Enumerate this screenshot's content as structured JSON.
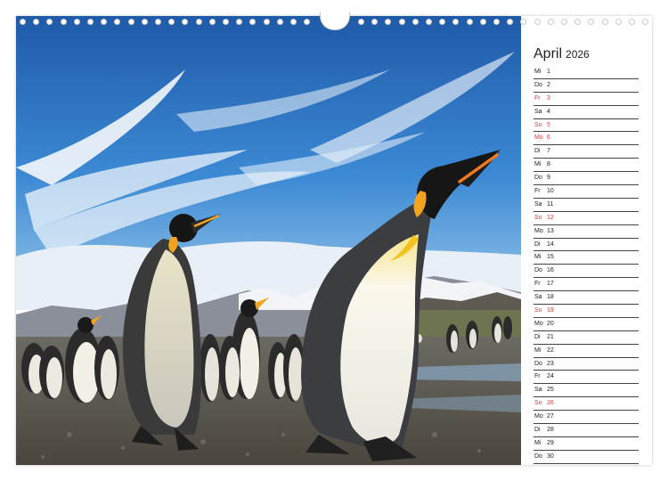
{
  "calendar": {
    "month": "April",
    "year": "2026",
    "days": [
      {
        "wd": "Mi",
        "d": "1",
        "red": false
      },
      {
        "wd": "Do",
        "d": "2",
        "red": false
      },
      {
        "wd": "Fr",
        "d": "3",
        "red": true
      },
      {
        "wd": "Sa",
        "d": "4",
        "red": false
      },
      {
        "wd": "So",
        "d": "5",
        "red": true
      },
      {
        "wd": "Mo",
        "d": "6",
        "red": true
      },
      {
        "wd": "Di",
        "d": "7",
        "red": false
      },
      {
        "wd": "Mi",
        "d": "8",
        "red": false
      },
      {
        "wd": "Do",
        "d": "9",
        "red": false
      },
      {
        "wd": "Fr",
        "d": "10",
        "red": false
      },
      {
        "wd": "Sa",
        "d": "11",
        "red": false
      },
      {
        "wd": "So",
        "d": "12",
        "red": true
      },
      {
        "wd": "Mo",
        "d": "13",
        "red": false
      },
      {
        "wd": "Di",
        "d": "14",
        "red": false
      },
      {
        "wd": "Mi",
        "d": "15",
        "red": false
      },
      {
        "wd": "Do",
        "d": "16",
        "red": false
      },
      {
        "wd": "Fr",
        "d": "17",
        "red": false
      },
      {
        "wd": "Sa",
        "d": "18",
        "red": false
      },
      {
        "wd": "So",
        "d": "19",
        "red": true
      },
      {
        "wd": "Mo",
        "d": "20",
        "red": false
      },
      {
        "wd": "Di",
        "d": "21",
        "red": false
      },
      {
        "wd": "Mi",
        "d": "22",
        "red": false
      },
      {
        "wd": "Do",
        "d": "23",
        "red": false
      },
      {
        "wd": "Fr",
        "d": "24",
        "red": false
      },
      {
        "wd": "Sa",
        "d": "25",
        "red": false
      },
      {
        "wd": "So",
        "d": "26",
        "red": true
      },
      {
        "wd": "Mo",
        "d": "27",
        "red": false
      },
      {
        "wd": "Di",
        "d": "28",
        "red": false
      },
      {
        "wd": "Mi",
        "d": "29",
        "red": false
      },
      {
        "wd": "Do",
        "d": "30",
        "red": false
      }
    ]
  },
  "colors": {
    "sky_top": "#1f5fb0",
    "sky_bottom": "#8fc3ea",
    "holiday_red": "#d23a3a",
    "penguin_orange": "#f2a41e"
  },
  "photo": {
    "subject": "king penguins on a beach"
  }
}
